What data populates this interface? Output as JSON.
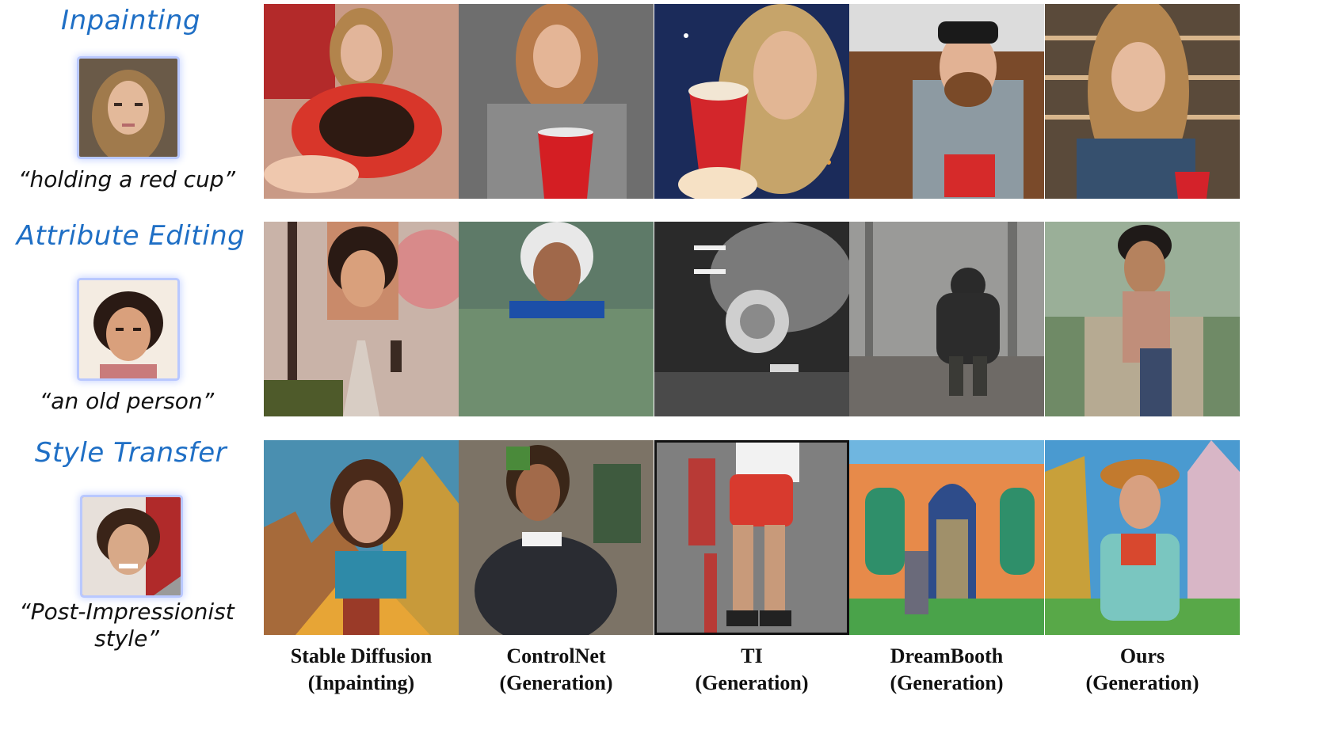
{
  "rows": [
    {
      "title": "Inpainting",
      "prompt": "“holding a red cup”"
    },
    {
      "title": "Attribute Editing",
      "prompt": "“an old person”"
    },
    {
      "title": "Style Transfer",
      "prompt_line1": "“Post-Impressionist",
      "prompt_line2": "style”"
    }
  ],
  "columns": [
    {
      "line1": "Stable Diffusion",
      "line2": "(Inpainting)"
    },
    {
      "line1": "ControlNet",
      "line2": "(Generation)"
    },
    {
      "line1": "TI",
      "line2": "(Generation)"
    },
    {
      "line1": "DreamBooth",
      "line2": "(Generation)"
    },
    {
      "line1": "Ours",
      "line2": "(Generation)"
    }
  ],
  "colors": {
    "title": "#1f6fc5",
    "thumb_glow": "#b9c8ff"
  }
}
